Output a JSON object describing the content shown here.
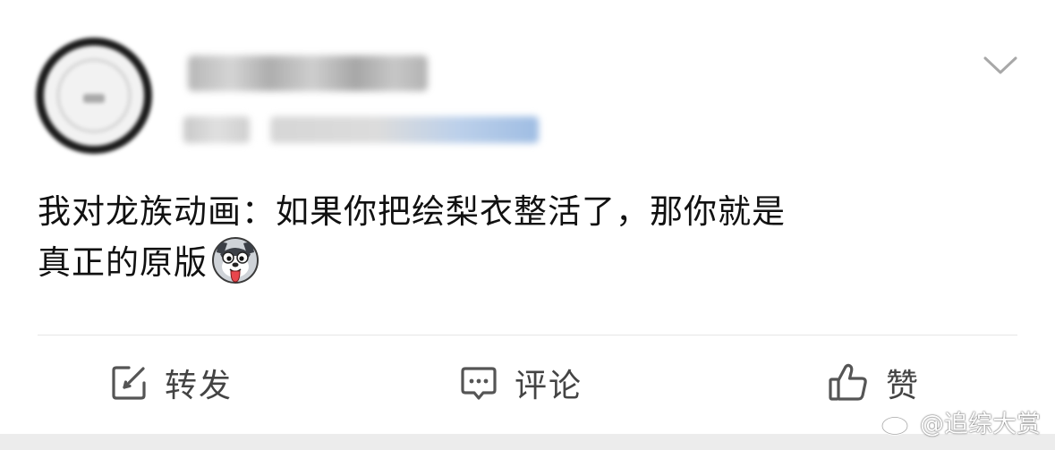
{
  "post": {
    "text_line1": "我对龙族动画：如果你把绘梨衣整活了，那你就是",
    "text_line2": "真正的原版",
    "emoji_icon": "husky-dog-emoji"
  },
  "actions": {
    "repost_label": "转发",
    "comment_label": "评论",
    "like_label": "赞"
  },
  "header": {
    "menu_icon": "chevron-down-icon"
  },
  "watermark": {
    "text": "@追综大赏",
    "icon": "weibo-logo-icon"
  },
  "colors": {
    "text": "#111111",
    "action_text": "#444444",
    "icon_stroke": "#555555",
    "divider": "#e6e6e6",
    "footer_bg": "#ececec"
  }
}
